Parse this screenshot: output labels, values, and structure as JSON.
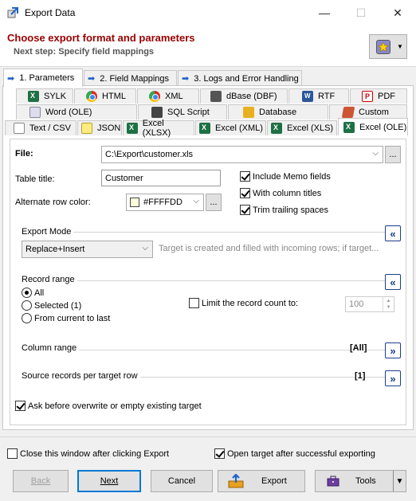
{
  "window": {
    "title": "Export Data",
    "min_glyph": "—",
    "max_glyph": "☐",
    "close_glyph": "✕"
  },
  "header": {
    "title": "Choose export format and parameters",
    "subtitle": "Next step: Specify field mappings"
  },
  "steps": [
    {
      "label": "1. Parameters",
      "active": true
    },
    {
      "label": "2. Field Mappings",
      "active": false
    },
    {
      "label": "3. Logs and Error Handling",
      "active": false
    }
  ],
  "format_tabs": {
    "row1": [
      {
        "label": "SYLK",
        "icon": "excel-icon"
      },
      {
        "label": "HTML",
        "icon": "chrome-icon"
      },
      {
        "label": "XML",
        "icon": "chrome-icon"
      },
      {
        "label": "dBase (DBF)",
        "icon": "dbf-icon"
      },
      {
        "label": "RTF",
        "icon": "word-icon"
      },
      {
        "label": "PDF",
        "icon": "pdf-icon"
      }
    ],
    "row2": [
      {
        "label": "Word (OLE)",
        "icon": "word-doc-icon"
      },
      {
        "label": "SQL Script",
        "icon": "sql-icon"
      },
      {
        "label": "Database",
        "icon": "database-icon"
      },
      {
        "label": "Custom",
        "icon": "custom-icon"
      }
    ],
    "row3": [
      {
        "label": "Text / CSV",
        "icon": "text-icon"
      },
      {
        "label": "JSON",
        "icon": "json-icon"
      },
      {
        "label": "Excel (XLSX)",
        "icon": "excel-icon"
      },
      {
        "label": "Excel (XML)",
        "icon": "excel-icon"
      },
      {
        "label": "Excel (XLS)",
        "icon": "excel-icon"
      },
      {
        "label": "Excel (OLE)",
        "icon": "excel-icon",
        "active": true
      }
    ]
  },
  "form": {
    "file_label": "File:",
    "file_value": "C:\\Export\\customer.xls",
    "browse_label": "...",
    "table_title_label": "Table title:",
    "table_title_value": "Customer",
    "alt_row_color_label": "Alternate row color:",
    "alt_row_color_value": "#FFFFDD",
    "color_swatch": "#FFFFDD",
    "include_memo": {
      "label": "Include Memo fields",
      "checked": true
    },
    "column_titles": {
      "label": "With column titles",
      "checked": true
    },
    "trim_spaces": {
      "label": "Trim trailing spaces",
      "checked": true
    }
  },
  "export_mode": {
    "title": "Export Mode",
    "value": "Replace+Insert",
    "description": "Target is created and filled with incoming rows; if target...",
    "collapse_glyph": "«"
  },
  "record_range": {
    "title": "Record range",
    "options": [
      "All",
      "Selected (1)",
      "From current to last"
    ],
    "selected": "All",
    "limit_label": "Limit the record count to:",
    "limit_checked": false,
    "limit_value": "100",
    "collapse_glyph": "«"
  },
  "column_range": {
    "title": "Column range",
    "value": "[All]",
    "expand_glyph": "»"
  },
  "source_records": {
    "title": "Source records per target row",
    "value": "[1]",
    "expand_glyph": "»"
  },
  "ask_overwrite": {
    "label": "Ask before overwrite or empty existing target",
    "checked": true
  },
  "footer": {
    "close_after": {
      "label": "Close this window after clicking Export",
      "checked": false
    },
    "open_target": {
      "label": "Open target after successful exporting",
      "checked": true
    }
  },
  "buttons": {
    "back": "Back",
    "next": "Next",
    "cancel": "Cancel",
    "export": "Export",
    "tools": "Tools"
  }
}
